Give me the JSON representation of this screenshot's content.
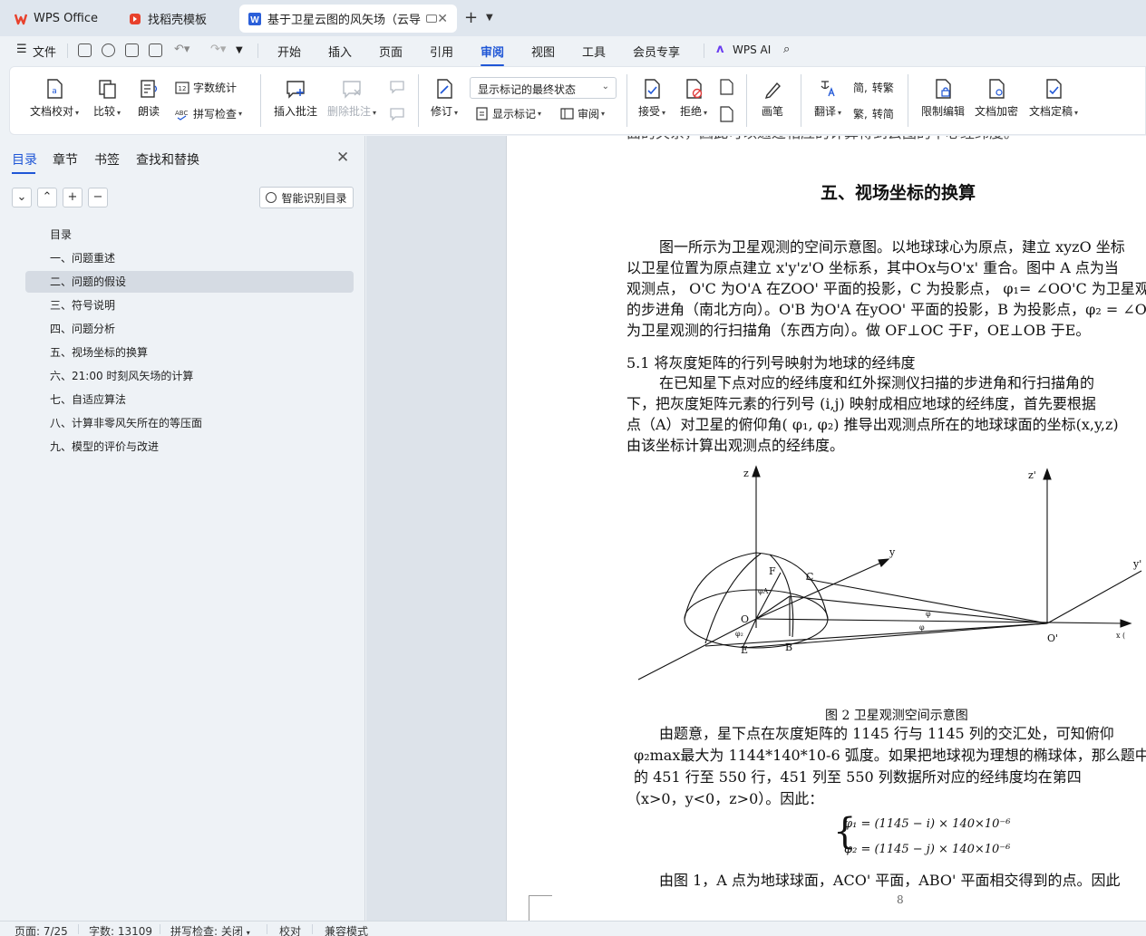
{
  "tabs": {
    "wps_office": "WPS Office",
    "daoke": "找稻壳模板",
    "document": "基于卫星云图的风矢场（云导"
  },
  "menu": {
    "file": "文件",
    "items": [
      "开始",
      "插入",
      "页面",
      "引用",
      "审阅",
      "视图",
      "工具",
      "会员专享"
    ],
    "active": "审阅",
    "wps_ai": "WPS AI"
  },
  "ribbon": {
    "doc_check": "文档校对",
    "compare": "比较",
    "read_aloud": "朗读",
    "word_count": "字数统计",
    "spell_check": "拼写检查",
    "insert_comment": "插入批注",
    "delete_comment": "删除批注",
    "track_changes": "修订",
    "markup_mode": "显示标记的最终状态",
    "show_markup": "显示标记",
    "review": "审阅",
    "accept": "接受",
    "reject": "拒绝",
    "pen": "画笔",
    "translate": "翻译",
    "to_simplified": "转繁",
    "to_simplified_char": "简,",
    "to_traditional": "转简",
    "to_traditional_char": "繁,",
    "restrict_edit": "限制编辑",
    "encrypt": "文档加密",
    "finalize": "文档定稿"
  },
  "nav": {
    "tabs": [
      "目录",
      "章节",
      "书签",
      "查找和替换"
    ],
    "smart_toc": "智能识别目录",
    "toc": [
      "目录",
      "一、问题重述",
      "二、问题的假设",
      "三、符号说明",
      "四、问题分析",
      "五、视场坐标的换算",
      "六、21:00 时刻风矢场的计算",
      "七、自适应算法",
      "八、计算非零风矢所在的等压面",
      "九、模型的评价与改进"
    ],
    "selected_index": 2
  },
  "document": {
    "top_cut": "面的关系，因此可以通过相应的计算得到云图的中心经纬度。",
    "section_title": "五、视场坐标的换算",
    "p1": [
      "图一所示为卫星观测的空间示意图。以地球球心为原点，建立 xyzO 坐标",
      "以卫星位置为原点建立 x'y'z'O 坐标系，其中Ox与O'x' 重合。图中 A 点为当",
      "观测点， O'C 为O'A 在ZOO' 平面的投影，C 为投影点， φ₁= ∠OO'C 为卫星观",
      "的步进角（南北方向）。O'B 为O'A 在yOO' 平面的投影，B 为投影点，φ₂ = ∠O",
      "为卫星观测的行扫描角（东西方向）。做 OF⊥OC 于F，OE⊥OB 于E。"
    ],
    "subsection": "5.1 将灰度矩阵的行列号映射为地球的经纬度",
    "p2": [
      "在已知星下点对应的经纬度和红外探测仪扫描的步进角和行扫描角的",
      "下，把灰度矩阵元素的行列号 (i,j) 映射成相应地球的经纬度，首先要根据",
      "点（A）对卫星的俯仰角( φ₁, φ₂) 推导出观测点所在的地球球面的坐标(x,y,z)",
      "由该坐标计算出观测点的经纬度。"
    ],
    "figure_caption": "图 2 卫星观测空间示意图",
    "figure_labels": {
      "z": "z",
      "z2": "z'",
      "y": "y",
      "y2": "y'",
      "x": "x (",
      "O": "O",
      "O2": "O'",
      "F": "F",
      "C": "C",
      "E": "E",
      "B": "B",
      "phiA": "φA",
      "phi2": "φ₂",
      "phi_a": "φ",
      "phi_b": "φ"
    },
    "p3": [
      "由题意，星下点在灰度矩阵的 1145 行与 1145 列的交汇处，可知俯仰",
      "φ₂max最大为 1144*140*10-6 弧度。如果把地球视为理想的椭球体，那么题中",
      "的 451 行至 550 行，451 列至 550 列数据所对应的经纬度均在第四",
      "（x>0，y<0，z>0）。因此："
    ],
    "eq1": "φ₁ = (1145 − i) × 140×10⁻⁶",
    "eq2": "φ₂ = (1145 − j) × 140×10⁻⁶",
    "p4": "由图 1，A 点为地球球面，ACO' 平面，ABO' 平面相交得到的点。因此",
    "page_number": "8"
  },
  "status": {
    "page": "页面: 7/25",
    "words": "字数: 13109",
    "spell": "拼写检查: 关闭",
    "proof": "校对",
    "compat": "兼容模式"
  },
  "colors": {
    "accent": "#1f56d6",
    "wps_red": "#e8412c",
    "doc_blue": "#2b5fd9"
  }
}
